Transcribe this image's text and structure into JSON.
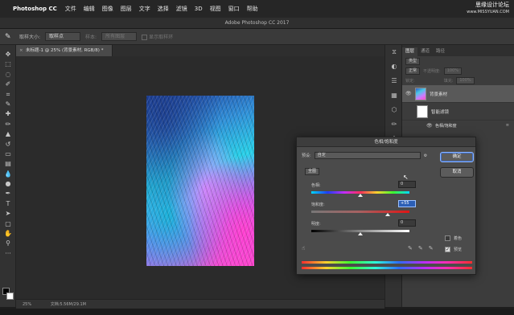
{
  "menubar": {
    "app": "Photoshop CC",
    "items": [
      "文件",
      "编辑",
      "图像",
      "图层",
      "文字",
      "选择",
      "滤镜",
      "3D",
      "视图",
      "窗口",
      "帮助"
    ],
    "watermark_title": "思缘设计论坛",
    "watermark_url": "www.MISSYUAN.COM"
  },
  "window": {
    "title": "Adobe Photoshop CC 2017"
  },
  "options_bar": {
    "sample_size_label": "取样大小:",
    "sample_size_value": "取样点",
    "sample_label": "样本:",
    "sample_value": "所有图层",
    "show_ring_label": "显示取样环"
  },
  "document": {
    "tab_label": "未标题-1 @ 25% (背景素材, RGB/8) *",
    "zoom": "25%",
    "doc_info": "文档:5.56M/29.1M"
  },
  "layers_panel": {
    "tabs": [
      "图层",
      "通道",
      "路径"
    ],
    "kind_label": "类型",
    "blend_mode": "正常",
    "opacity_label": "不透明度:",
    "opacity_value": "100%",
    "lock_label": "锁定:",
    "fill_label": "填充:",
    "fill_value": "100%",
    "layer_name": "背景素材",
    "smart_filter": "智能滤镜",
    "filter_name": "色相/饱和度"
  },
  "hue_sat_dialog": {
    "title": "色相/饱和度",
    "preset_label": "预设:",
    "preset_value": "自定",
    "channel_value": "全图",
    "hue_label": "色相:",
    "hue_value": "0",
    "saturation_label": "饱和度:",
    "saturation_value": "+55",
    "lightness_label": "明度:",
    "lightness_value": "0",
    "ok_label": "确定",
    "cancel_label": "取消",
    "colorize_label": "着色",
    "preview_label": "预览",
    "hue_level": 0.5,
    "saturation_level": 0.775,
    "lightness_level": 0.5
  }
}
